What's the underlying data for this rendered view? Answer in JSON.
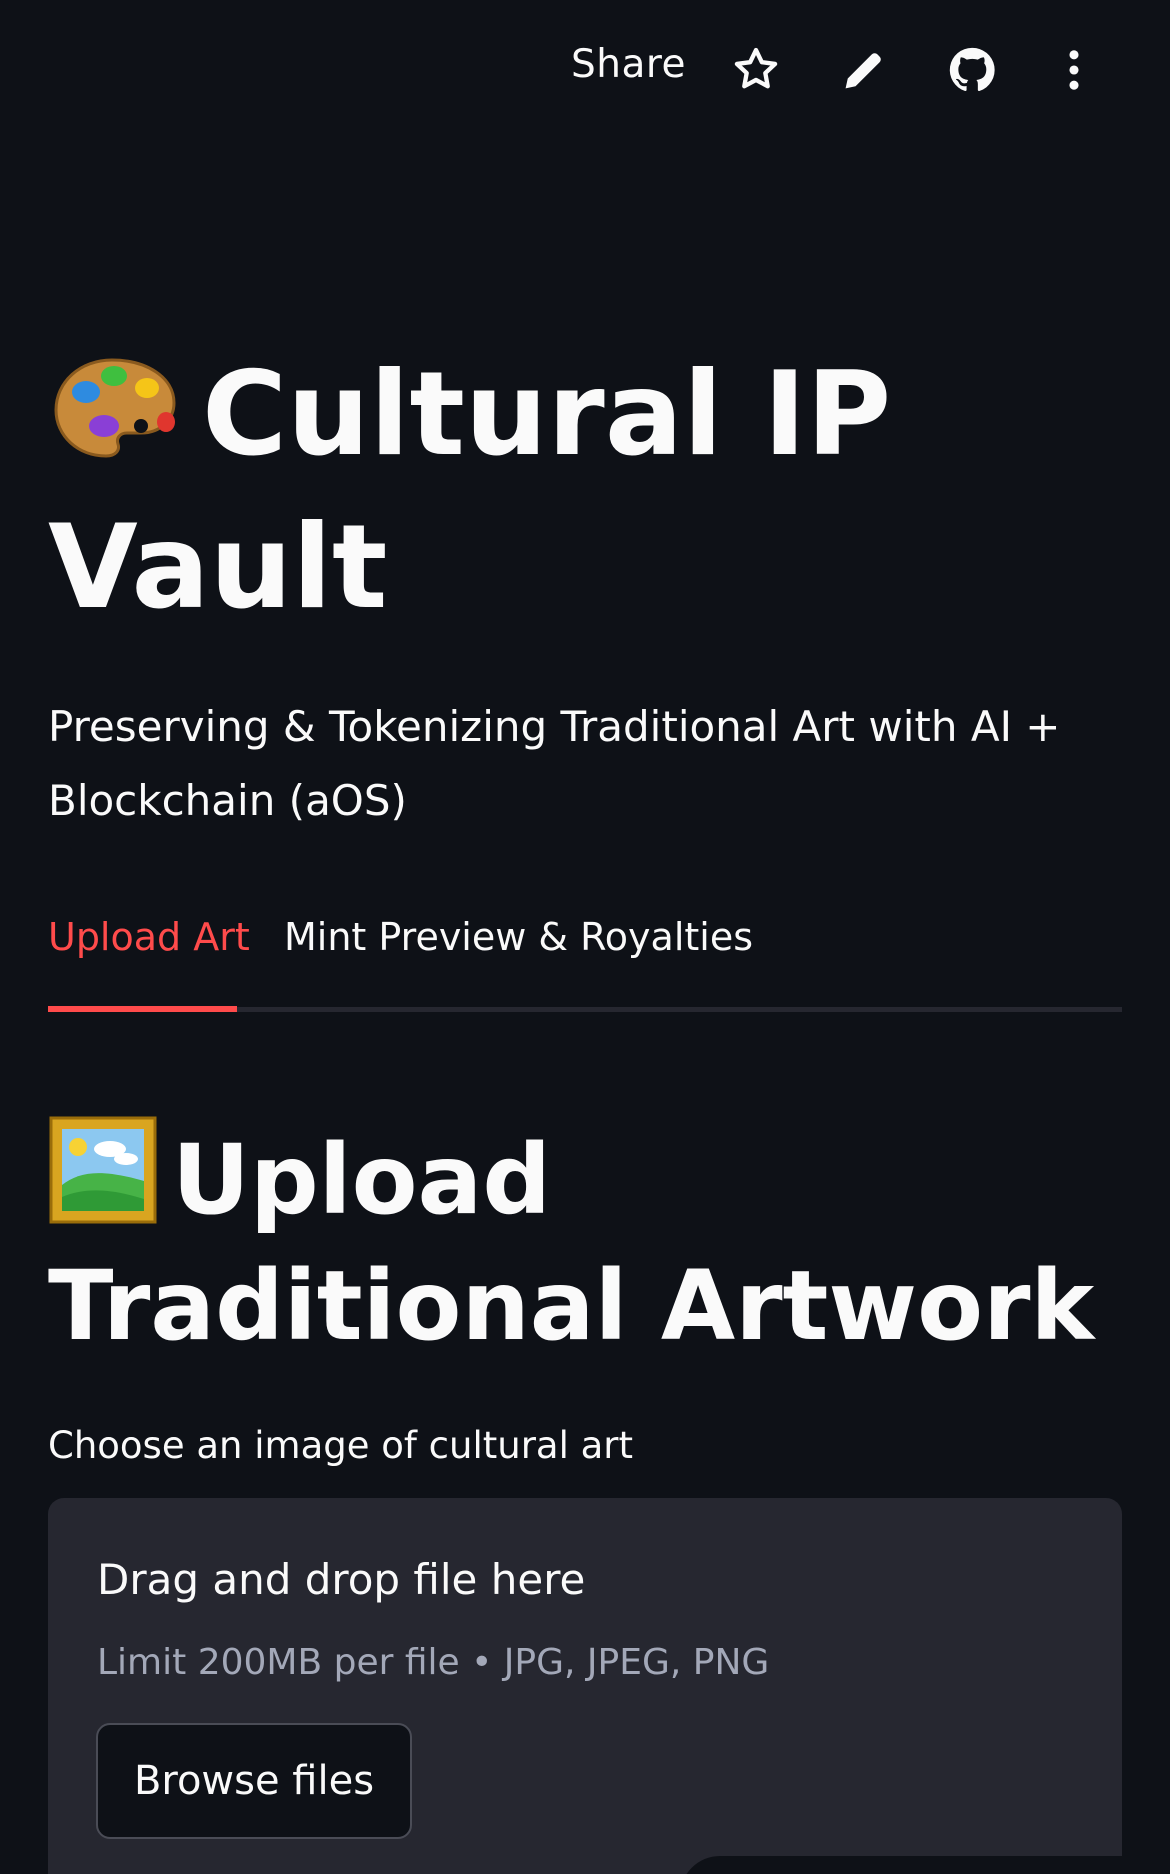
{
  "toolbar": {
    "share_label": "Share",
    "icons": [
      "star-icon",
      "pencil-icon",
      "github-icon",
      "more-vertical-icon"
    ]
  },
  "header": {
    "title_emoji": "🎨",
    "title": "Cultural IP Vault",
    "subtitle": "Preserving & Tokenizing Traditional Art with AI + Blockchain (aOS)"
  },
  "tabs": [
    {
      "label": "Upload Art",
      "active": true
    },
    {
      "label": "Mint Preview & Royalties",
      "active": false
    }
  ],
  "upload_section": {
    "heading_emoji": "🖼️",
    "heading": "Upload Traditional Artwork",
    "uploader_label": "Choose an image of cultural art",
    "dropzone_title": "Drag and drop file here",
    "dropzone_limit": "Limit 200MB per file • JPG, JPEG, PNG",
    "browse_label": "Browse files"
  },
  "colors": {
    "background": "#0e1117",
    "surface": "#262730",
    "accent": "#ff4b4b",
    "text": "#fafafa",
    "muted_text": "#a3a8b8"
  }
}
